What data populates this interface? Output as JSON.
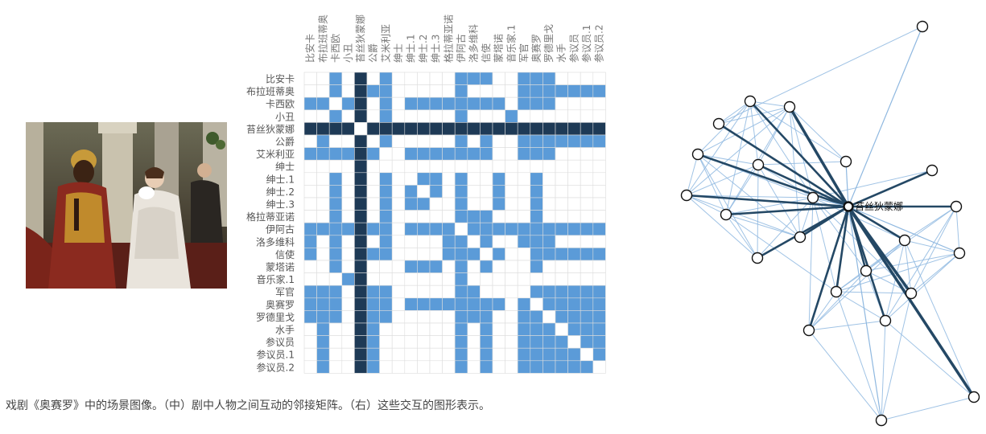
{
  "painting": {
    "description_icon": "painting-image"
  },
  "caption": "戏剧《奥赛罗》中的场景图像。（中）剧中人物之间互动的邻接矩阵。（右）这些交互的图形表示。",
  "matrix": {
    "characters": [
      "比安卡",
      "布拉班蒂奥",
      "卡西欧",
      "小丑",
      "苔丝狄蒙娜",
      "公爵",
      "艾米利亚",
      "绅士",
      "绅士.1",
      "绅士.2",
      "绅士.3",
      "格拉蒂亚诺",
      "伊阿古",
      "洛多维科",
      "信使",
      "蒙塔诺",
      "音乐家.1",
      "军官",
      "奥赛罗",
      "罗德里戈",
      "水手",
      "参议员",
      "参议员.1",
      "参议员.2"
    ],
    "highlight_index": 4,
    "colors": {
      "link": "#5b9bd8",
      "highlight": "#1e3a56",
      "empty": "#ffffff",
      "grid": "#dddddd"
    }
  },
  "graph": {
    "center_label": "苔丝狄蒙娜",
    "colors": {
      "thin": "#8fb8e0",
      "thick": "#244865",
      "node_fill": "#ffffff",
      "node_stroke": "#111111"
    }
  }
}
